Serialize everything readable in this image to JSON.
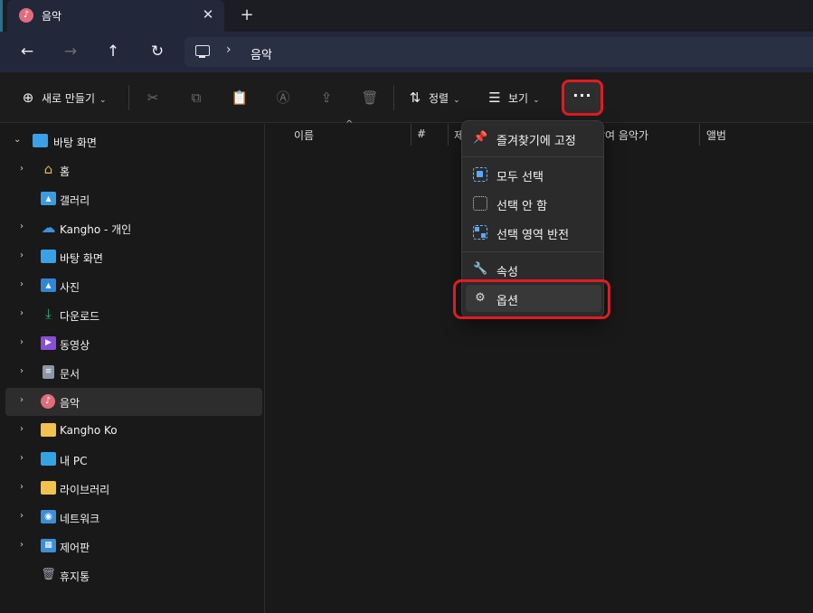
{
  "window": {
    "tab_title": "음악",
    "tab_close": "✕",
    "new_tab": "+"
  },
  "nav": {
    "back": "←",
    "forward": "→",
    "up": "↑",
    "refresh": "↻",
    "breadcrumb_sep": "›",
    "breadcrumb": "음악"
  },
  "toolbar": {
    "new_label": "새로 만들기",
    "sort_label": "정렬",
    "view_label": "보기",
    "more_label": "···",
    "chevron": "⌄"
  },
  "sidebar": {
    "items": [
      {
        "label": "바탕 화면",
        "icon": "desktop-icon",
        "color": "#3aa0e8"
      },
      {
        "label": "홈",
        "icon": "home-icon",
        "color": "#e8b24a"
      },
      {
        "label": "갤러리",
        "icon": "gallery-icon",
        "color": "#3b9be0"
      },
      {
        "label": "Kangho - 개인",
        "icon": "cloud-icon",
        "color": "#3d8fe0"
      },
      {
        "label": "바탕 화면",
        "icon": "desktop-icon",
        "color": "#3aa0e8"
      },
      {
        "label": "사진",
        "icon": "pictures-icon",
        "color": "#2f86d6"
      },
      {
        "label": "다운로드",
        "icon": "download-icon",
        "color": "#2bb673"
      },
      {
        "label": "동영상",
        "icon": "video-icon",
        "color": "#8a4fd8"
      },
      {
        "label": "문서",
        "icon": "document-icon",
        "color": "#8d97a8"
      },
      {
        "label": "음악",
        "icon": "music-icon",
        "color": "#e06d7c"
      },
      {
        "label": "Kangho Ko",
        "icon": "folder-icon",
        "color": "#f2c14e"
      },
      {
        "label": "내 PC",
        "icon": "pc-icon",
        "color": "#34a3e6"
      },
      {
        "label": "라이브러리",
        "icon": "library-icon",
        "color": "#f2c14e"
      },
      {
        "label": "네트워크",
        "icon": "network-icon",
        "color": "#3a8fd8"
      },
      {
        "label": "제어판",
        "icon": "control-panel-icon",
        "color": "#3a8fd8"
      },
      {
        "label": "휴지통",
        "icon": "recycle-bin-icon",
        "color": "#9aa3ad"
      }
    ]
  },
  "columns": {
    "name": "이름",
    "number": "#",
    "title": "제",
    "artist": "참여 음악가",
    "album": "앨범"
  },
  "menu": {
    "pin": "즐겨찾기에 고정",
    "select_all": "모두 선택",
    "select_none": "선택 안 함",
    "invert": "선택 영역 반전",
    "properties": "속성",
    "options": "옵션"
  }
}
